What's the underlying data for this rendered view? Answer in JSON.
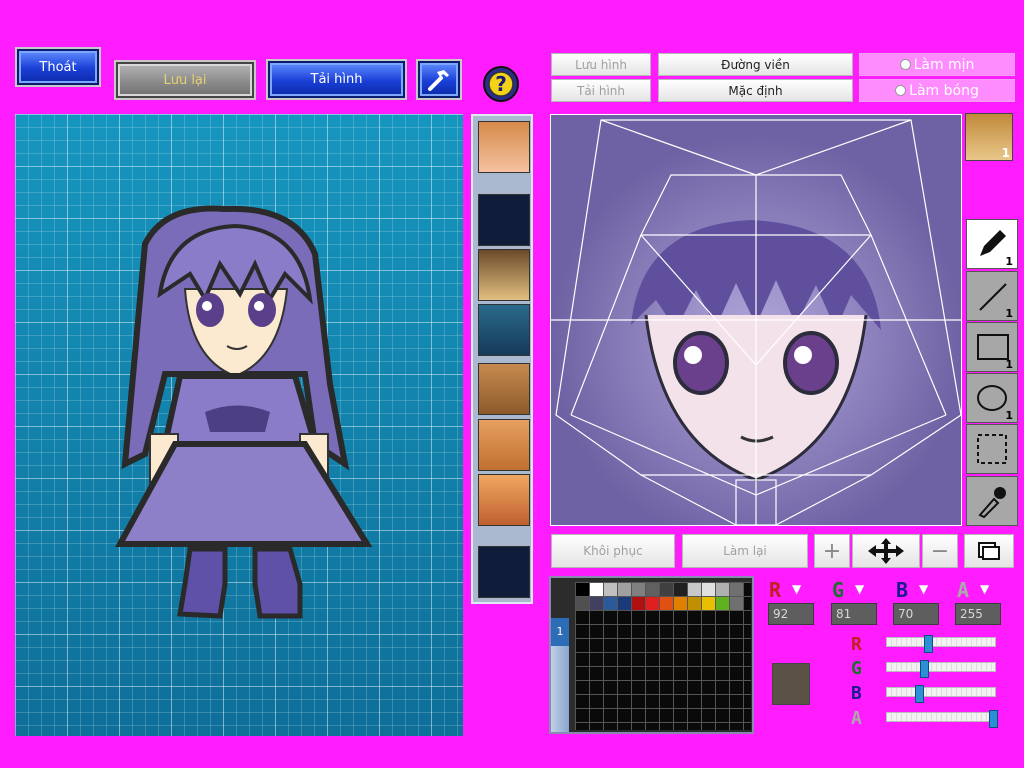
{
  "toolbar_left": {
    "exit": "Thoát",
    "save": "Lưu lại",
    "load": "Tải hình",
    "hammer_icon": "hammer-icon",
    "help_icon": "question-mark-icon"
  },
  "toolbar_right": {
    "save_image": "Lưu hình",
    "outline": "Đường viền",
    "smooth": "Làm mịn",
    "load_image": "Tải hình",
    "default": "Mặc định",
    "shading": "Làm bóng"
  },
  "face_counter": "1",
  "tools": [
    {
      "name": "pen",
      "count": "1"
    },
    {
      "name": "line",
      "count": "1"
    },
    {
      "name": "rectangle",
      "count": "1"
    },
    {
      "name": "ellipse",
      "count": "1"
    },
    {
      "name": "selection",
      "count": ""
    },
    {
      "name": "eyedropper",
      "count": ""
    }
  ],
  "bottom_buttons": {
    "restore": "Khôi phục",
    "redo": "Làm lại"
  },
  "palette": {
    "layer_index": "1",
    "swatches": [
      "#000000",
      "#ffffff",
      "#c0c0c0",
      "#a0a0a0",
      "#808080",
      "#606060",
      "#404040",
      "#202020",
      "#c8c8c8",
      "#e0e0e0",
      "#b0b0b0",
      "#707070",
      "#505050",
      "#404060",
      "#2a5a9a",
      "#1a3a7a",
      "#b01010",
      "#e02020",
      "#e05010",
      "#e08000",
      "#c09000",
      "#e8c000",
      "#60b020",
      "#707070"
    ]
  },
  "color": {
    "r_label": "R",
    "g_label": "G",
    "b_label": "B",
    "a_label": "A",
    "r": "92",
    "g": "81",
    "b": "70",
    "a": "255",
    "r_level": 0.36,
    "g_level": 0.32,
    "b_level": 0.27,
    "a_level": 1.0,
    "preview": "#5c5146"
  },
  "colors": {
    "background": "#ff1cff",
    "accent_blue": "#1a3fd6",
    "hair_purple": "#7a6cb8",
    "dress_purple": "#8a7cc4"
  }
}
